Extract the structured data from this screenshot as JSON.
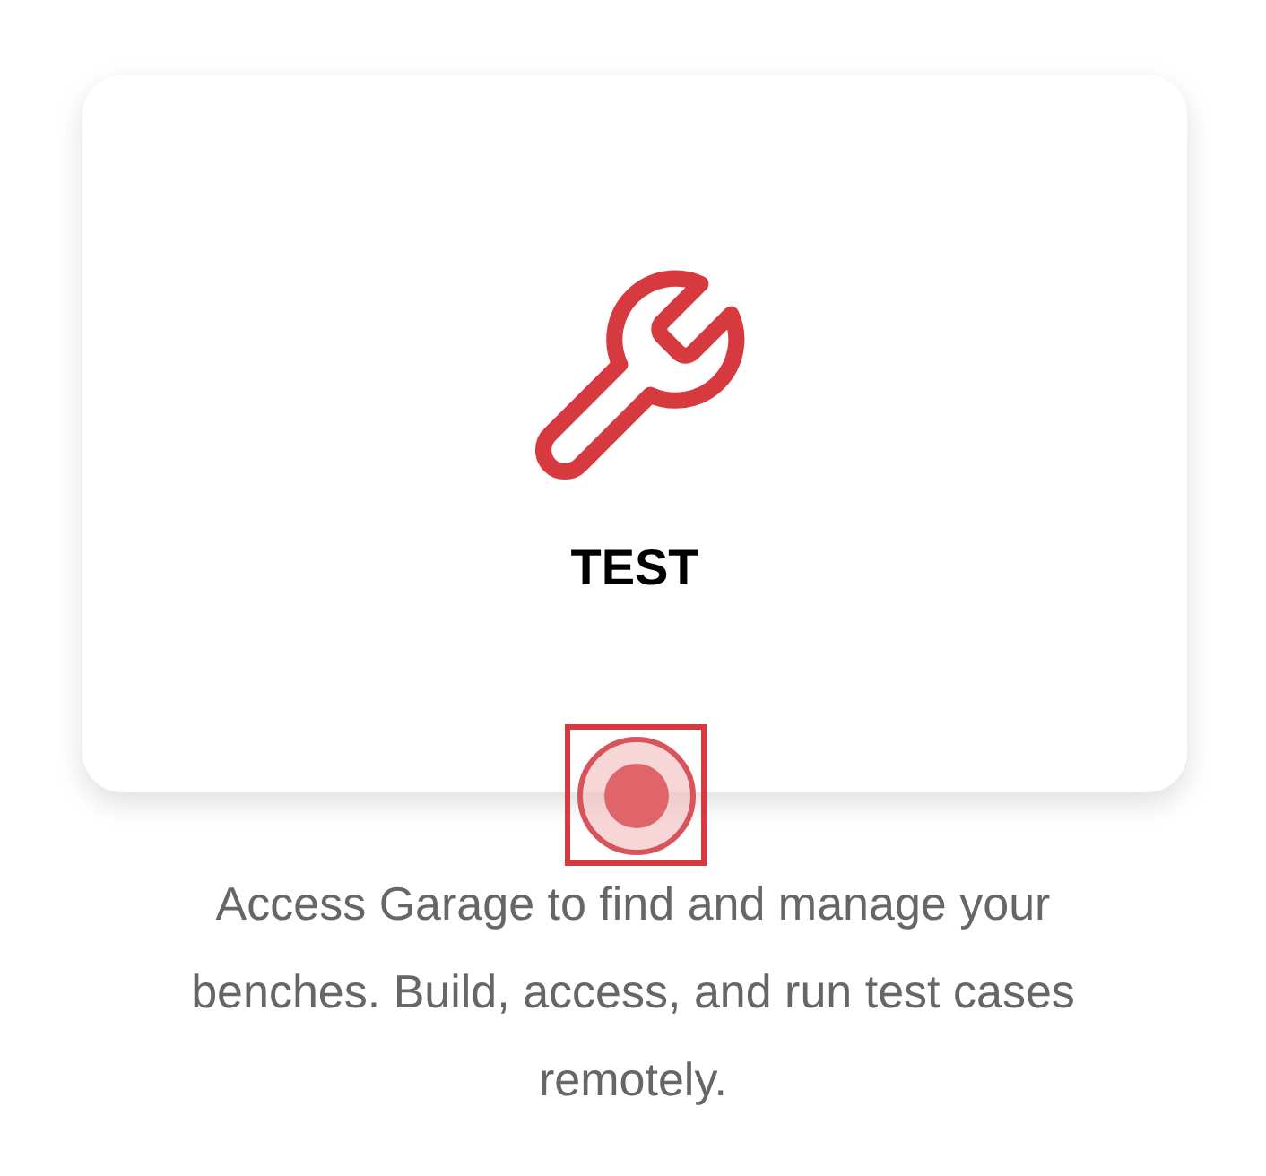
{
  "card": {
    "title": "TEST"
  },
  "description": "Access Garage to find and manage your benches. Build, access, and run test cases remotely."
}
